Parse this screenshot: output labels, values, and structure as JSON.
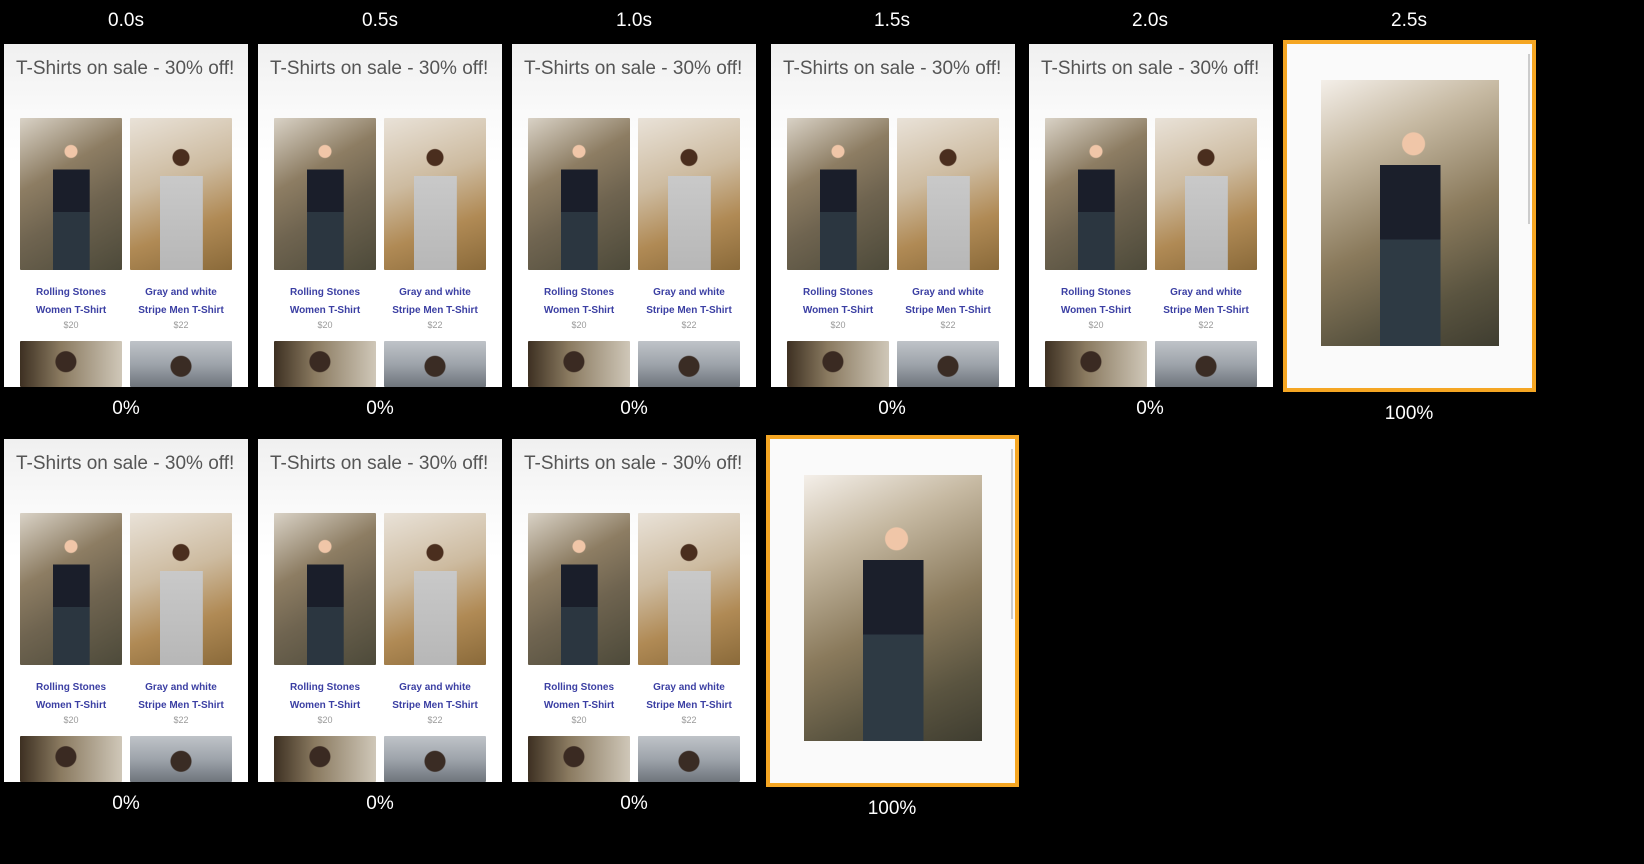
{
  "timestamps": [
    "0.0s",
    "0.5s",
    "1.0s",
    "1.5s",
    "2.0s",
    "2.5s"
  ],
  "row1_progress": [
    "0%",
    "0%",
    "0%",
    "0%",
    "0%",
    "100%"
  ],
  "row2_progress": [
    "0%",
    "0%",
    "0%",
    "100%"
  ],
  "page": {
    "title": "T-Shirts on sale - 30% off!",
    "products": [
      {
        "name_line1": "Rolling Stones",
        "name_line2": "Women T-Shirt",
        "price": "$20"
      },
      {
        "name_line1": "Gray and white",
        "name_line2": "Stripe Men T-Shirt",
        "price": "$22"
      }
    ]
  },
  "colors": {
    "highlight": "#f5a623",
    "product_link": "#3b3fa3",
    "background": "#000000"
  }
}
